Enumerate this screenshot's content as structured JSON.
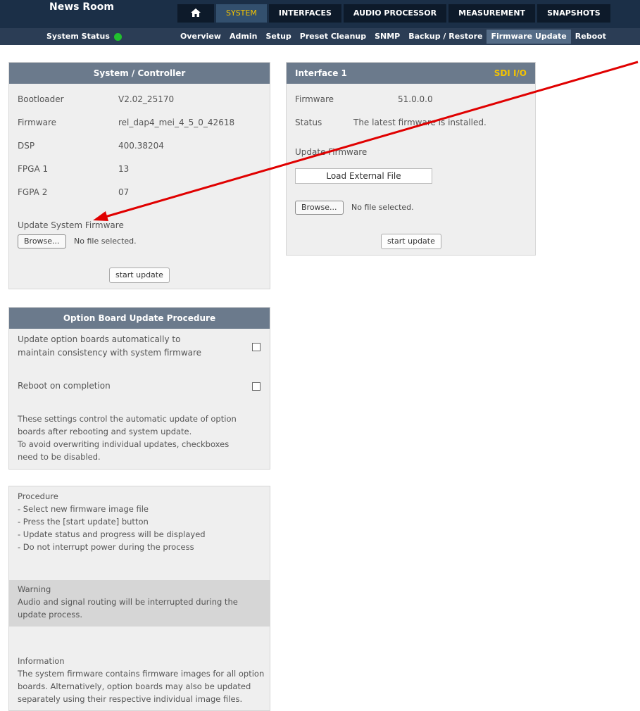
{
  "header": {
    "brand": "News Room",
    "main_tabs": [
      "SYSTEM",
      "INTERFACES",
      "AUDIO PROCESSOR",
      "MEASUREMENT",
      "SNAPSHOTS"
    ],
    "active_tab": "SYSTEM",
    "home_icon": "home-icon"
  },
  "subnav": {
    "status_label": "System Status",
    "status_color": "#21c02e",
    "items": [
      "Overview",
      "Admin",
      "Setup",
      "Preset Cleanup",
      "SNMP",
      "Backup / Restore",
      "Firmware Update",
      "Reboot"
    ],
    "active_item": "Firmware Update"
  },
  "system_panel": {
    "title": "System / Controller",
    "rows": [
      {
        "label": "Bootloader",
        "value": "V2.02_25170"
      },
      {
        "label": "Firmware",
        "value": "rel_dap4_mei_4_5_0_42618"
      },
      {
        "label": "DSP",
        "value": "400.38204"
      },
      {
        "label": "FPGA 1",
        "value": "13"
      },
      {
        "label": "FGPA 2",
        "value": "07"
      }
    ],
    "update_label": "Update System Firmware",
    "browse_label": "Browse...",
    "no_file": "No file selected.",
    "start_label": "start update"
  },
  "interface_panel": {
    "title": "Interface 1",
    "type": "SDI I/O",
    "type_color": "#f5c400",
    "firmware_label": "Firmware",
    "firmware_value": "51.0.0.0",
    "status_label": "Status",
    "status_value": "The latest firmware is installed.",
    "update_label": "Update Firmware",
    "load_external_label": "Load External File",
    "browse_label": "Browse...",
    "no_file": "No file selected.",
    "start_label": "start update"
  },
  "option_panel": {
    "title": "Option Board Update Procedure",
    "auto_update_line1": "Update option boards automatically to",
    "auto_update_line2": "maintain consistency with system firmware",
    "auto_update_checked": false,
    "reboot_label": "Reboot on completion",
    "reboot_checked": false,
    "note_lines": [
      "These settings control the automatic update of option",
      "boards after rebooting and system update.",
      "To avoid overwriting individual updates, checkboxes",
      "need to be disabled."
    ]
  },
  "info_panel": {
    "procedure_lines": [
      "Procedure",
      "- Select new firmware image file",
      "- Press the [start update] button",
      "- Update status and progress will be displayed",
      "- Do not interrupt power during the process"
    ],
    "warning_lines": [
      "Warning",
      "Audio and signal routing will be interrupted during the",
      "update process."
    ],
    "information_lines": [
      "Information",
      "The system firmware contains firmware images for all option",
      "boards. Alternatively, option boards may also be updated",
      "separately using their respective individual image files."
    ]
  },
  "annotation": {
    "arrow_color": "#e00000"
  }
}
